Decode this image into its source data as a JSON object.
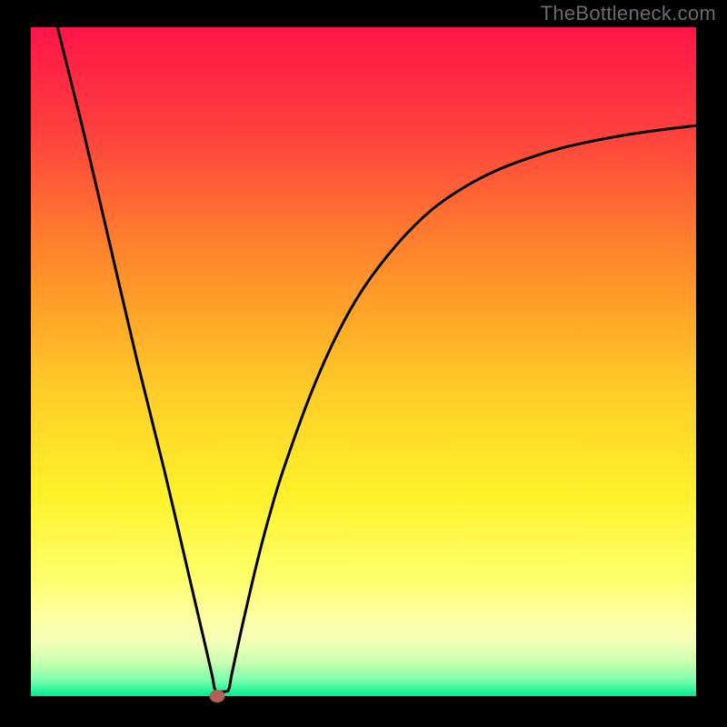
{
  "attribution": "TheBottleneck.com",
  "colors": {
    "frame": "#000000",
    "stroke": "#000000",
    "marker_fill": "#b36058",
    "marker_stroke": "#b36058",
    "gradient_stops": [
      {
        "offset": 0.0,
        "color": "#ff1549"
      },
      {
        "offset": 0.15,
        "color": "#ff3e3e"
      },
      {
        "offset": 0.35,
        "color": "#ff8a2a"
      },
      {
        "offset": 0.55,
        "color": "#ffce27"
      },
      {
        "offset": 0.7,
        "color": "#fff22a"
      },
      {
        "offset": 0.82,
        "color": "#ffff6a"
      },
      {
        "offset": 0.88,
        "color": "#ffffa0"
      },
      {
        "offset": 0.92,
        "color": "#f2ffb8"
      },
      {
        "offset": 0.95,
        "color": "#c7ffb0"
      },
      {
        "offset": 0.975,
        "color": "#7fffb0"
      },
      {
        "offset": 1.0,
        "color": "#00ed8e"
      }
    ]
  },
  "chart_data": {
    "type": "line",
    "title": "",
    "xlabel": "",
    "ylabel": "",
    "ylim": [
      0,
      100
    ],
    "xlim": [
      0,
      100
    ],
    "marker": {
      "x": 28,
      "y": 0
    },
    "series": [
      {
        "name": "curve",
        "points": [
          {
            "x": 4.0,
            "y": 100.0
          },
          {
            "x": 6.0,
            "y": 92.0
          },
          {
            "x": 8.0,
            "y": 84.0
          },
          {
            "x": 12.0,
            "y": 67.0
          },
          {
            "x": 16.0,
            "y": 50.0
          },
          {
            "x": 20.0,
            "y": 34.0
          },
          {
            "x": 24.0,
            "y": 17.0
          },
          {
            "x": 26.0,
            "y": 8.5
          },
          {
            "x": 27.2,
            "y": 3.3
          },
          {
            "x": 27.6,
            "y": 1.2
          },
          {
            "x": 28.0,
            "y": 0.7
          },
          {
            "x": 29.4,
            "y": 0.7
          },
          {
            "x": 29.8,
            "y": 1.2
          },
          {
            "x": 30.2,
            "y": 3.3
          },
          {
            "x": 31.0,
            "y": 7.0
          },
          {
            "x": 32.0,
            "y": 11.5
          },
          {
            "x": 34.0,
            "y": 20.0
          },
          {
            "x": 36.0,
            "y": 27.5
          },
          {
            "x": 38.0,
            "y": 34.0
          },
          {
            "x": 42.0,
            "y": 45.0
          },
          {
            "x": 46.0,
            "y": 54.0
          },
          {
            "x": 50.0,
            "y": 61.0
          },
          {
            "x": 55.0,
            "y": 67.5
          },
          {
            "x": 60.0,
            "y": 72.5
          },
          {
            "x": 65.0,
            "y": 76.0
          },
          {
            "x": 70.0,
            "y": 78.6
          },
          {
            "x": 75.0,
            "y": 80.5
          },
          {
            "x": 80.0,
            "y": 82.0
          },
          {
            "x": 85.0,
            "y": 83.1
          },
          {
            "x": 90.0,
            "y": 84.0
          },
          {
            "x": 95.0,
            "y": 84.7
          },
          {
            "x": 100.0,
            "y": 85.3
          }
        ]
      }
    ]
  }
}
